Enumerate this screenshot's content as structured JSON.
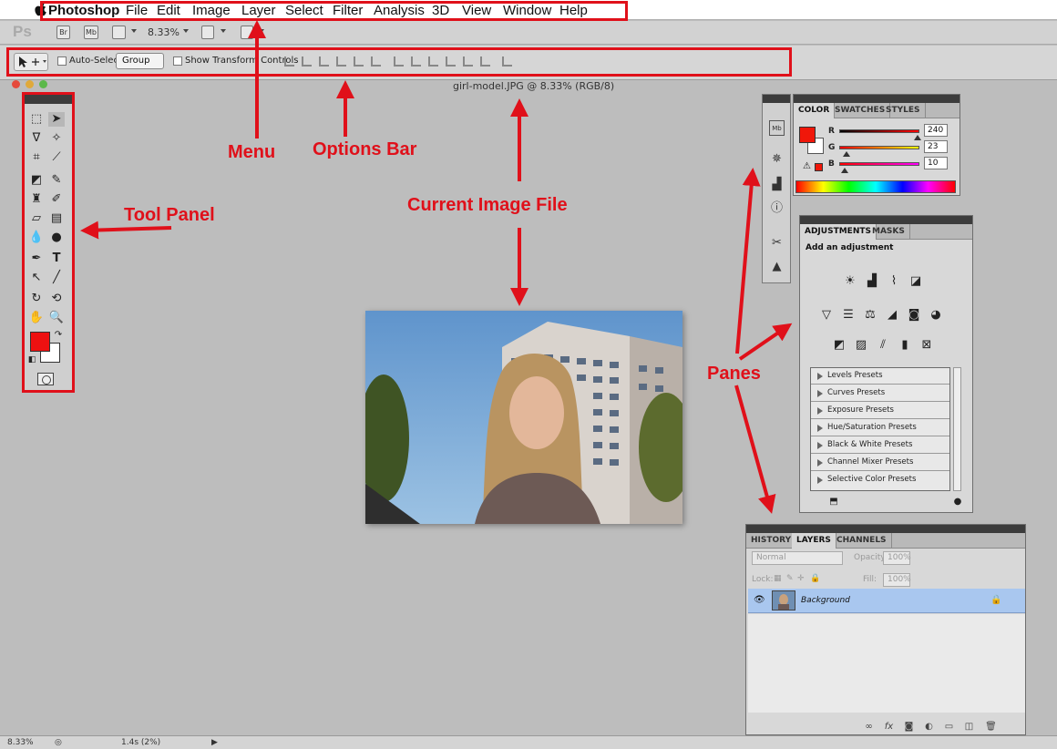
{
  "menubar": {
    "app_name": "Photoshop",
    "items": [
      "File",
      "Edit",
      "Image",
      "Layer",
      "Select",
      "Filter",
      "Analysis",
      "3D",
      "View",
      "Window",
      "Help"
    ]
  },
  "appbar": {
    "logo": "Ps",
    "bridge_label": "Br",
    "minibridge_label": "Mb",
    "zoom": "8.33%"
  },
  "options": {
    "auto_select_label": "Auto-Select:",
    "auto_select_value": "Group",
    "transform_label": "Show Transform Controls"
  },
  "document": {
    "title": "girl-model.JPG @ 8.33% (RGB/8)"
  },
  "annotations": {
    "menu": "Menu",
    "options_bar": "Options Bar",
    "tool_panel": "Tool Panel",
    "current_image": "Current Image File",
    "panes": "Panes"
  },
  "color_panel": {
    "tabs": [
      "COLOR",
      "SWATCHES",
      "STYLES"
    ],
    "r_label": "R",
    "g_label": "G",
    "b_label": "B",
    "r_value": "240",
    "g_value": "23",
    "b_value": "10",
    "fg_color": "#f0170a"
  },
  "adjustments_panel": {
    "tabs": [
      "ADJUSTMENTS",
      "MASKS"
    ],
    "heading": "Add an adjustment",
    "presets": [
      "Levels Presets",
      "Curves Presets",
      "Exposure Presets",
      "Hue/Saturation Presets",
      "Black & White Presets",
      "Channel Mixer Presets",
      "Selective Color Presets"
    ]
  },
  "layers_panel": {
    "tabs": [
      "HISTORY",
      "LAYERS",
      "CHANNELS"
    ],
    "blend_mode": "Normal",
    "opacity_label": "Opacity:",
    "opacity_value": "100%",
    "lock_label": "Lock:",
    "fill_label": "Fill:",
    "fill_value": "100%",
    "layer_name": "Background"
  },
  "statusbar": {
    "zoom": "8.33%",
    "timing": "1.4s (2%)"
  }
}
